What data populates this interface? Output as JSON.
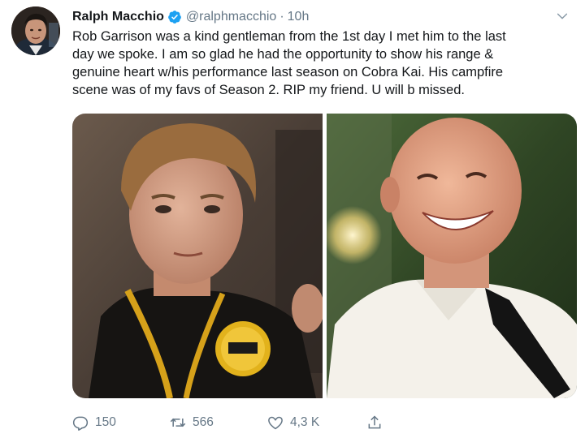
{
  "author": {
    "display_name": "Ralph Macchio",
    "handle": "@ralphmacchio",
    "separator": "·",
    "time": "10h",
    "verified": true
  },
  "tweet": {
    "lines": [
      "Rob Garrison was a kind gentleman from the 1st day I met him to the last",
      "day we spoke. I am so glad he had the opportunity to show his range &",
      "genuine heart w/his performance last season on Cobra Kai. His campfire",
      "scene was of my favs of Season 2. RIP my friend. U will b missed."
    ]
  },
  "actions": {
    "reply_count": "150",
    "retweet_count": "566",
    "like_count": "4,3 K"
  },
  "icons": {
    "verified": "verified-badge-icon",
    "caret": "chevron-down-icon",
    "reply": "reply-icon",
    "retweet": "retweet-icon",
    "like": "heart-icon",
    "share": "share-icon"
  },
  "colors": {
    "text": "#14171a",
    "secondary": "#657786",
    "verified": "#1da1f2"
  }
}
